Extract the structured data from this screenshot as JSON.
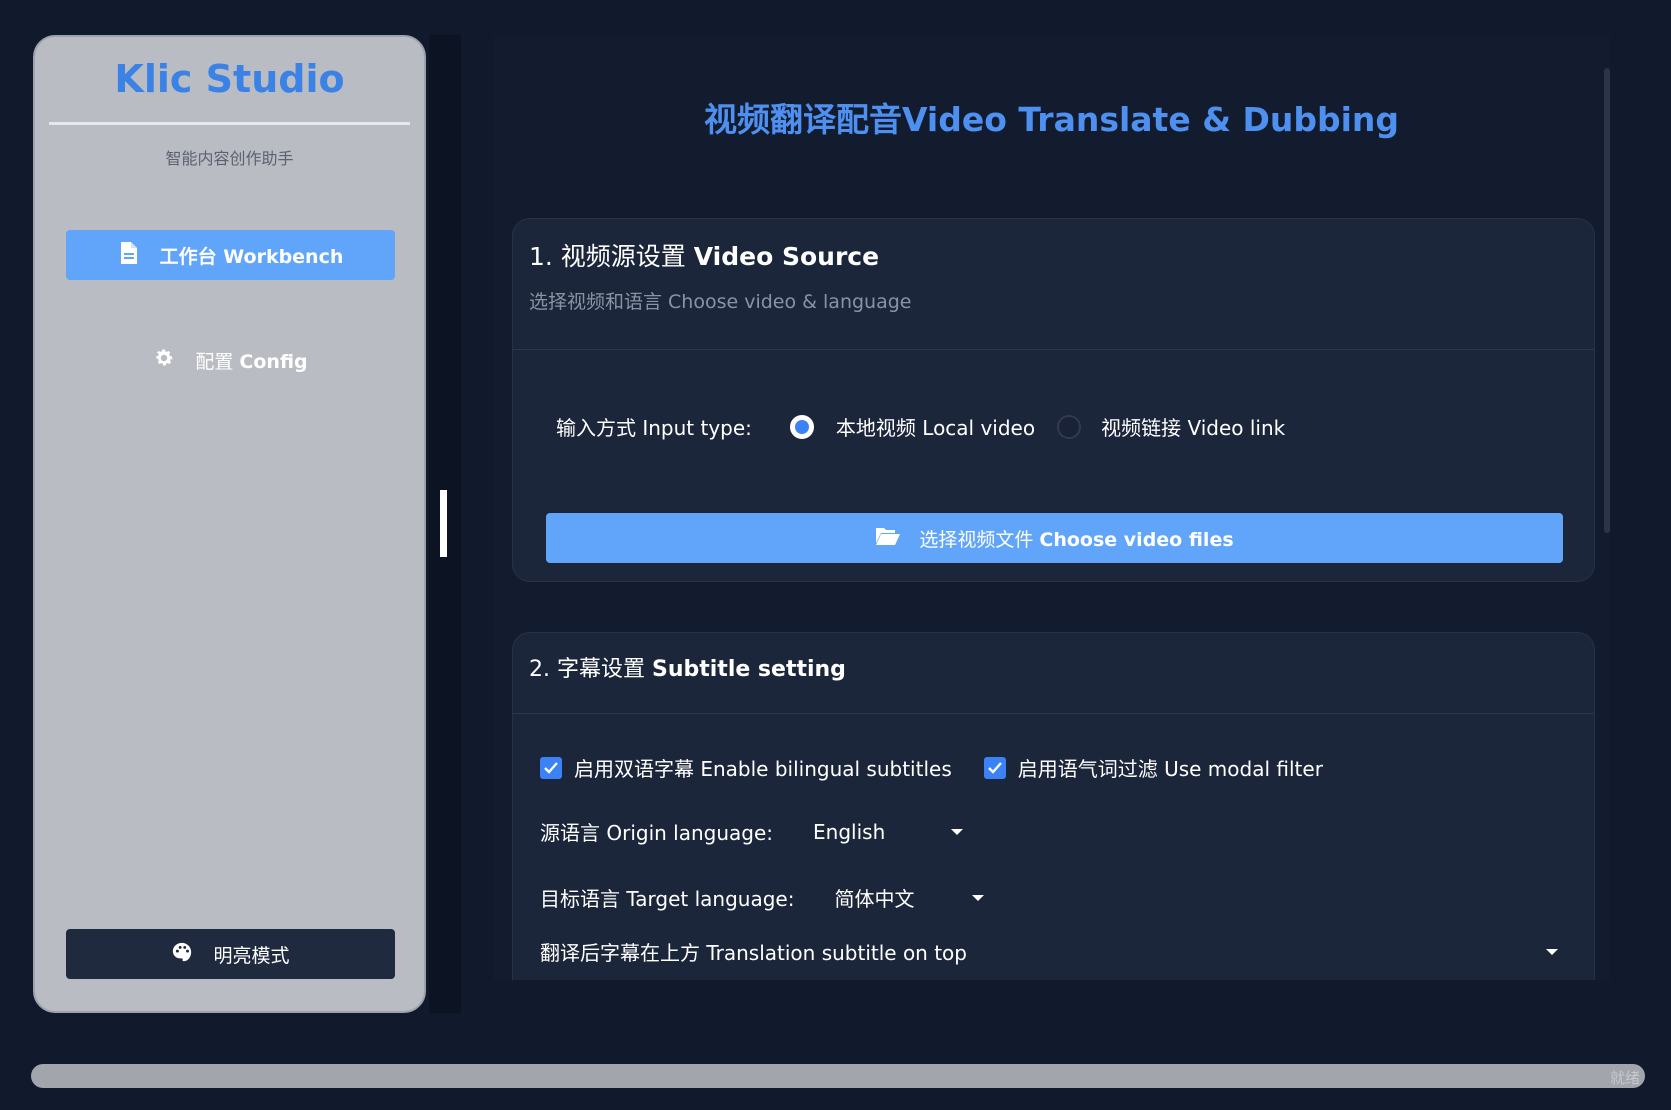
{
  "sidebar": {
    "brand": "Klic Studio",
    "tagline": "智能内容创作助手",
    "nav": [
      {
        "label_zh": "工作台",
        "label_en": "Workbench",
        "icon": "document-icon",
        "active": true
      },
      {
        "label_zh": "配置",
        "label_en": "Config",
        "icon": "gear-icon",
        "active": false
      }
    ],
    "theme_button": {
      "label": "明亮模式",
      "icon": "palette-icon"
    }
  },
  "main": {
    "title": "视频翻译配音Video Translate & Dubbing",
    "section1": {
      "title_zh": "1. 视频源设置",
      "title_en": "Video Source",
      "subtitle": "选择视频和语言 Choose video & language",
      "input_type_label": "输入方式 Input type:",
      "options": [
        {
          "label": "本地视频 Local video",
          "selected": true
        },
        {
          "label": "视频链接 Video link",
          "selected": false
        }
      ],
      "choose_button_zh": "选择视频文件",
      "choose_button_en": "Choose video files",
      "choose_button_icon": "folder-open-icon"
    },
    "section2": {
      "title_zh": "2. 字幕设置",
      "title_en": "Subtitle setting",
      "checkboxes": [
        {
          "label": "启用双语字幕 Enable bilingual subtitles",
          "checked": true
        },
        {
          "label": "启用语气词过滤 Use modal filter",
          "checked": true
        }
      ],
      "origin_language_label": "源语言 Origin language:",
      "origin_language_value": "English",
      "target_language_label": "目标语言 Target language:",
      "target_language_value": "简体中文",
      "position_value": "翻译后字幕在上方 Translation subtitle on top"
    }
  },
  "status": {
    "text": "就绪"
  },
  "colors": {
    "accent": "#60a5fa",
    "title_blue": "#4e90f0",
    "background": "#111a2c",
    "card": "#1c263a",
    "sidebar": "#b9bcc2"
  }
}
